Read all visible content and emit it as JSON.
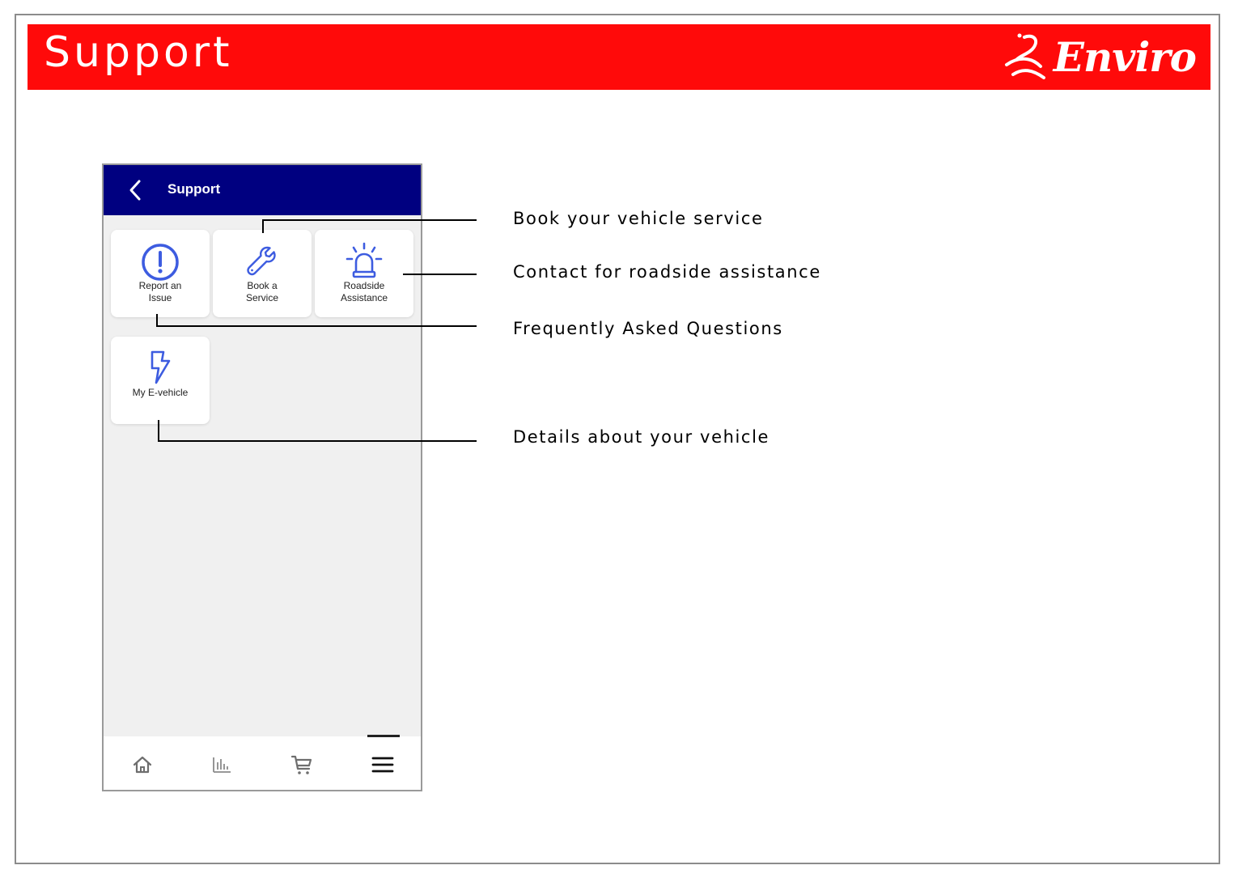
{
  "page": {
    "title": "Support",
    "brand_name": "Enviro"
  },
  "app": {
    "header_title": "Support",
    "tiles": [
      {
        "label_line1": "Report an",
        "label_line2": "Issue",
        "icon": "alert-circle-icon"
      },
      {
        "label_line1": "Book a",
        "label_line2": "Service",
        "icon": "wrench-icon"
      },
      {
        "label_line1": "Roadside",
        "label_line2": "Assistance",
        "icon": "siren-icon"
      },
      {
        "label_line1": "My E-vehicle",
        "label_line2": "",
        "icon": "lightning-bolt-icon"
      }
    ],
    "bottom_nav": [
      {
        "icon": "home-icon"
      },
      {
        "icon": "bar-chart-icon"
      },
      {
        "icon": "cart-icon"
      },
      {
        "icon": "menu-icon",
        "active": true
      }
    ]
  },
  "callouts": [
    "Book your vehicle service",
    "Contact for roadside assistance",
    "Frequently Asked Questions",
    "Details about your vehicle"
  ],
  "colors": {
    "banner": "#ff0a0a",
    "app_bar": "#000080",
    "icon_accent": "#3d5ce0",
    "phone_background": "#f0f0f0"
  }
}
